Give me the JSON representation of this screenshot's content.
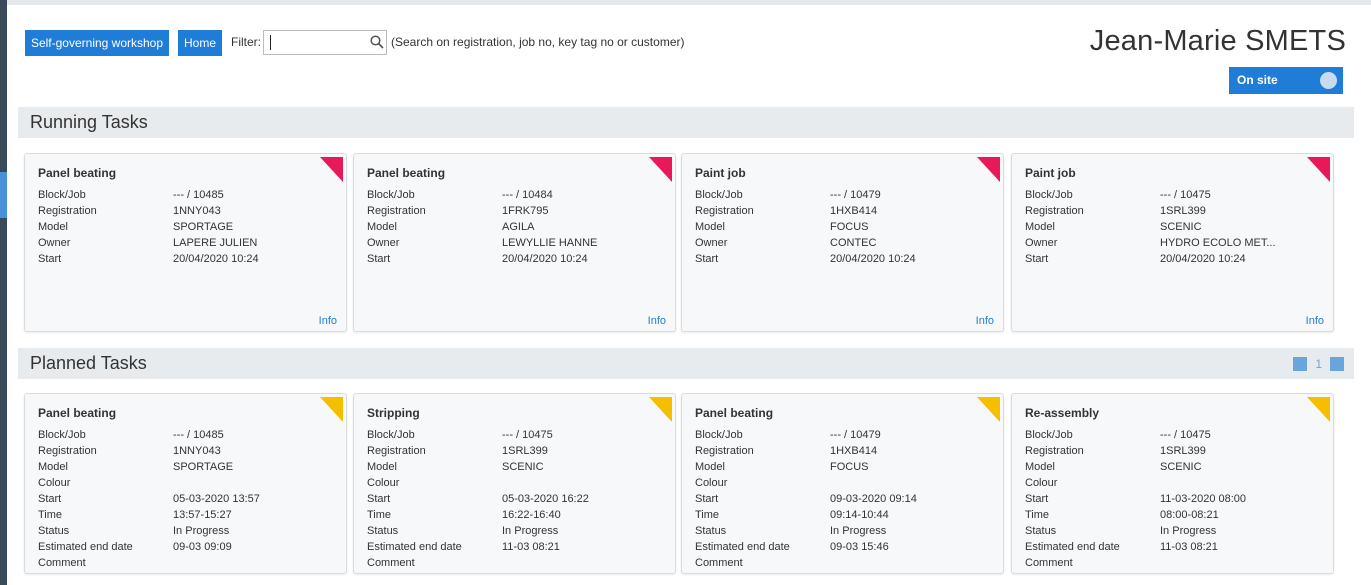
{
  "header": {
    "workshop_button": "Self-governing workshop",
    "home_button": "Home",
    "filter_label": "Filter:",
    "filter_value": "",
    "filter_hint": "(Search on registration, job no, key tag no or customer)",
    "user_name": "Jean-Marie SMETS",
    "onsite_label": "On site"
  },
  "colors": {
    "primary": "#1f7dd8",
    "running_marker": "#e8195a",
    "planned_marker": "#f5bf00"
  },
  "running": {
    "title": "Running Tasks",
    "cards": [
      {
        "title": "Panel beating",
        "info": "Info",
        "rows": [
          {
            "k": "Block/Job",
            "v": "--- / 10485"
          },
          {
            "k": "Registration",
            "v": "1NNY043"
          },
          {
            "k": "Model",
            "v": "SPORTAGE"
          },
          {
            "k": "Owner",
            "v": "LAPERE JULIEN"
          },
          {
            "k": "Start",
            "v": "20/04/2020 10:24"
          }
        ]
      },
      {
        "title": "Panel beating",
        "info": "Info",
        "rows": [
          {
            "k": "Block/Job",
            "v": "--- / 10484"
          },
          {
            "k": "Registration",
            "v": "1FRK795"
          },
          {
            "k": "Model",
            "v": "AGILA"
          },
          {
            "k": "Owner",
            "v": "LEWYLLIE HANNE"
          },
          {
            "k": "Start",
            "v": "20/04/2020 10:24"
          }
        ]
      },
      {
        "title": "Paint job",
        "info": "Info",
        "rows": [
          {
            "k": "Block/Job",
            "v": "--- / 10479"
          },
          {
            "k": "Registration",
            "v": "1HXB414"
          },
          {
            "k": "Model",
            "v": "FOCUS"
          },
          {
            "k": "Owner",
            "v": "CONTEC"
          },
          {
            "k": "Start",
            "v": "20/04/2020 10:24"
          }
        ]
      },
      {
        "title": "Paint job",
        "info": "Info",
        "rows": [
          {
            "k": "Block/Job",
            "v": "--- / 10475"
          },
          {
            "k": "Registration",
            "v": "1SRL399"
          },
          {
            "k": "Model",
            "v": "SCENIC"
          },
          {
            "k": "Owner",
            "v": "HYDRO ECOLO MET..."
          },
          {
            "k": "Start",
            "v": "20/04/2020 10:24"
          }
        ]
      }
    ]
  },
  "planned": {
    "title": "Planned Tasks",
    "page": "1",
    "cards": [
      {
        "title": "Panel beating",
        "rows": [
          {
            "k": "Block/Job",
            "v": "--- / 10485"
          },
          {
            "k": "Registration",
            "v": "1NNY043"
          },
          {
            "k": "Model",
            "v": "SPORTAGE"
          },
          {
            "k": "Colour",
            "v": ""
          },
          {
            "k": "Start",
            "v": "05-03-2020 13:57"
          },
          {
            "k": "Time",
            "v": "13:57-15:27"
          },
          {
            "k": "Status",
            "v": "In Progress"
          },
          {
            "k": "Estimated end date",
            "v": "09-03 09:09"
          },
          {
            "k": "Comment",
            "v": ""
          }
        ]
      },
      {
        "title": "Stripping",
        "rows": [
          {
            "k": "Block/Job",
            "v": "--- / 10475"
          },
          {
            "k": "Registration",
            "v": "1SRL399"
          },
          {
            "k": "Model",
            "v": "SCENIC"
          },
          {
            "k": "Colour",
            "v": ""
          },
          {
            "k": "Start",
            "v": "05-03-2020 16:22"
          },
          {
            "k": "Time",
            "v": "16:22-16:40"
          },
          {
            "k": "Status",
            "v": "In Progress"
          },
          {
            "k": "Estimated end date",
            "v": "11-03 08:21"
          },
          {
            "k": "Comment",
            "v": ""
          }
        ]
      },
      {
        "title": "Panel beating",
        "rows": [
          {
            "k": "Block/Job",
            "v": "--- / 10479"
          },
          {
            "k": "Registration",
            "v": "1HXB414"
          },
          {
            "k": "Model",
            "v": "FOCUS"
          },
          {
            "k": "Colour",
            "v": ""
          },
          {
            "k": "Start",
            "v": "09-03-2020 09:14"
          },
          {
            "k": "Time",
            "v": "09:14-10:44"
          },
          {
            "k": "Status",
            "v": "In Progress"
          },
          {
            "k": "Estimated end date",
            "v": "09-03 15:46"
          },
          {
            "k": "Comment",
            "v": ""
          }
        ]
      },
      {
        "title": "Re-assembly",
        "rows": [
          {
            "k": "Block/Job",
            "v": "--- / 10475"
          },
          {
            "k": "Registration",
            "v": "1SRL399"
          },
          {
            "k": "Model",
            "v": "SCENIC"
          },
          {
            "k": "Colour",
            "v": ""
          },
          {
            "k": "Start",
            "v": "11-03-2020 08:00"
          },
          {
            "k": "Time",
            "v": "08:00-08:21"
          },
          {
            "k": "Status",
            "v": "In Progress"
          },
          {
            "k": "Estimated end date",
            "v": "11-03 08:21"
          },
          {
            "k": "Comment",
            "v": ""
          }
        ]
      }
    ]
  }
}
